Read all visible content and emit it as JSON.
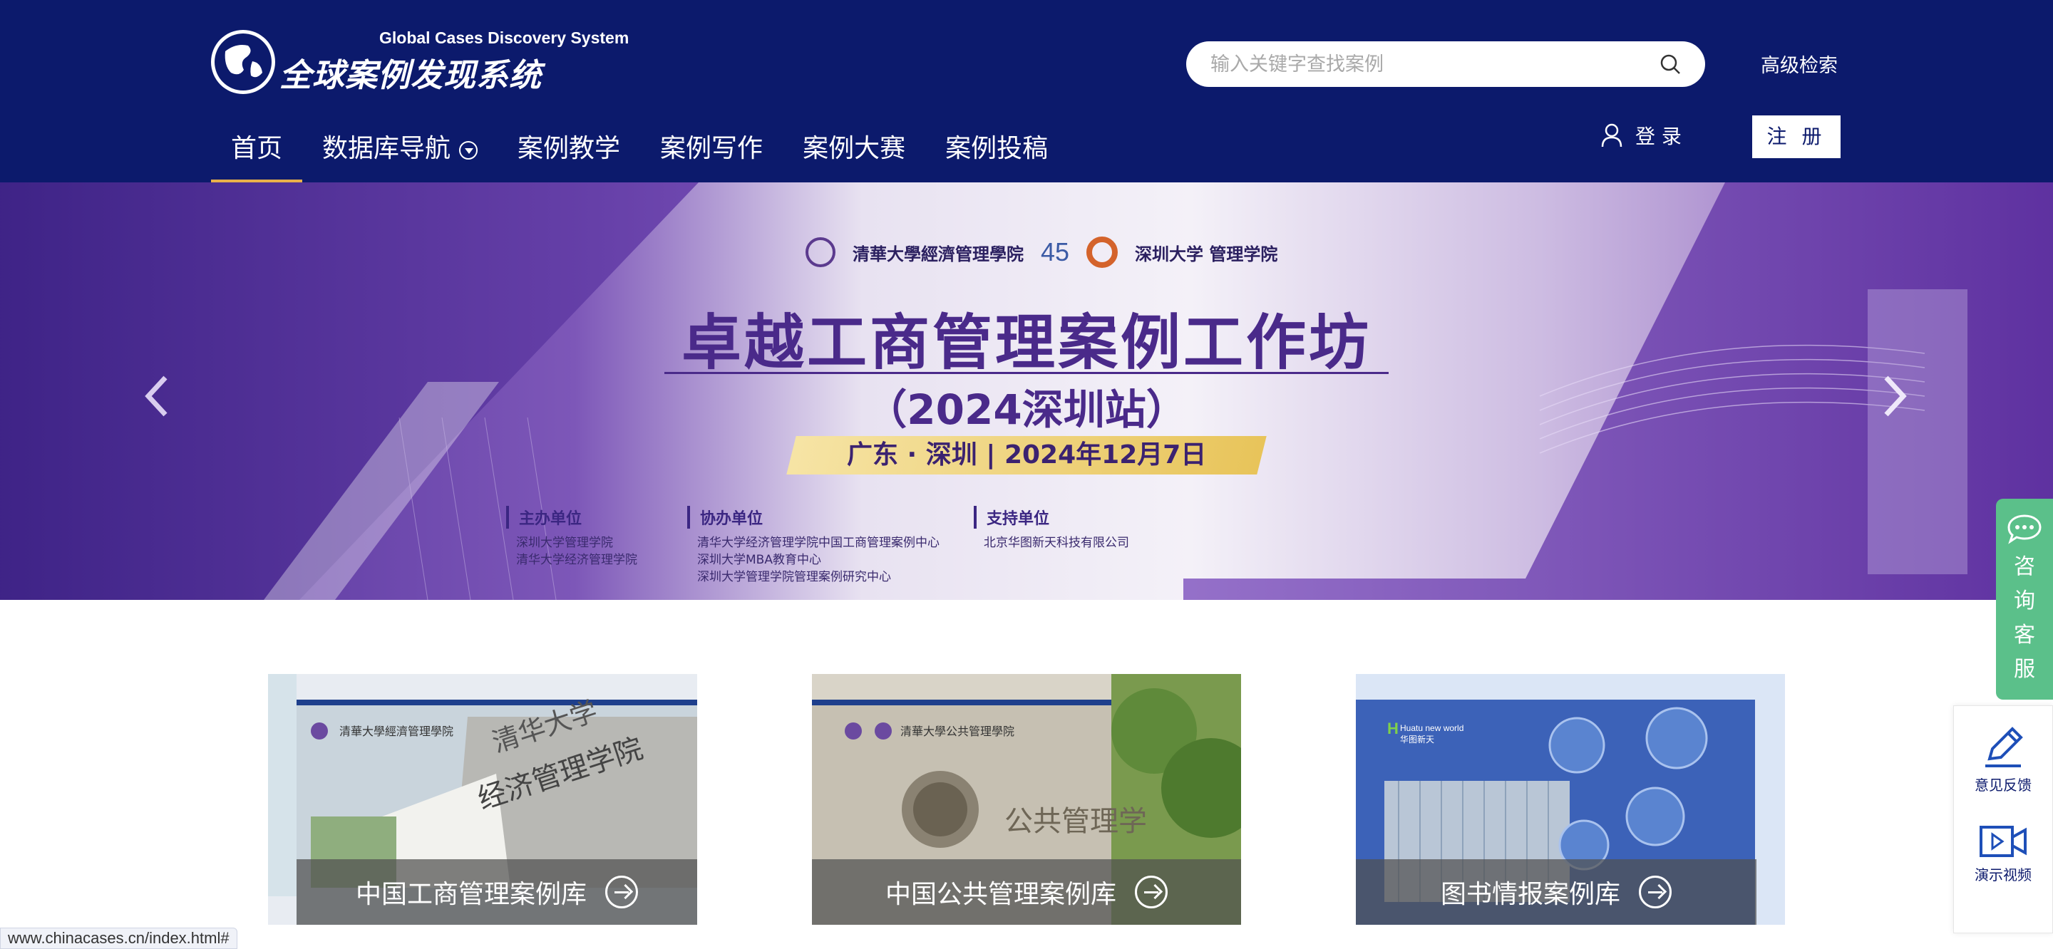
{
  "header": {
    "logo_en": "Global Cases Discovery System",
    "logo_cn": "全球案例发现系统",
    "search_placeholder": "输入关键字查找案例",
    "advanced_search": "高级检索",
    "login": "登 录",
    "register": "注 册"
  },
  "nav": {
    "items": [
      {
        "label": "首页",
        "active": true
      },
      {
        "label": "数据库导航",
        "active": false
      },
      {
        "label": "案例教学",
        "active": false
      },
      {
        "label": "案例写作",
        "active": false
      },
      {
        "label": "案例大赛",
        "active": false
      },
      {
        "label": "案例投稿",
        "active": false
      }
    ]
  },
  "banner": {
    "logo1_text": "清華大學經濟管理學院",
    "logo1_badge": "45",
    "logo2_text": "深圳大学 管理学院",
    "title": "卓越工商管理案例工作坊",
    "subtitle": "（2024深圳站）",
    "location_date": "广东 · 深圳  |  2024年12月7日",
    "host": {
      "heading": "主办单位",
      "lines": [
        "深圳大学管理学院",
        "清华大学经济管理学院"
      ]
    },
    "co_host": {
      "heading": "协办单位",
      "lines": [
        "清华大学经济管理学院中国工商管理案例中心",
        "深圳大学MBA教育中心",
        "深圳大学管理学院管理案例研究中心"
      ]
    },
    "support": {
      "heading": "支持单位",
      "lines": [
        "北京华图新天科技有限公司"
      ]
    }
  },
  "cards": [
    {
      "label": "中国工商管理案例库"
    },
    {
      "label": "中国公共管理案例库"
    },
    {
      "label": "图书情报案例库"
    }
  ],
  "side": {
    "consult": "咨询客服",
    "feedback": "意见反馈",
    "demo": "演示视频"
  },
  "status_bar": "www.chinacases.cn/index.html#",
  "colors": {
    "header_bg": "#0c1a6c",
    "nav_active_underline": "#e9b04a",
    "consult_bg": "#5bc08a",
    "banner_purple": "#4a2a8a"
  }
}
